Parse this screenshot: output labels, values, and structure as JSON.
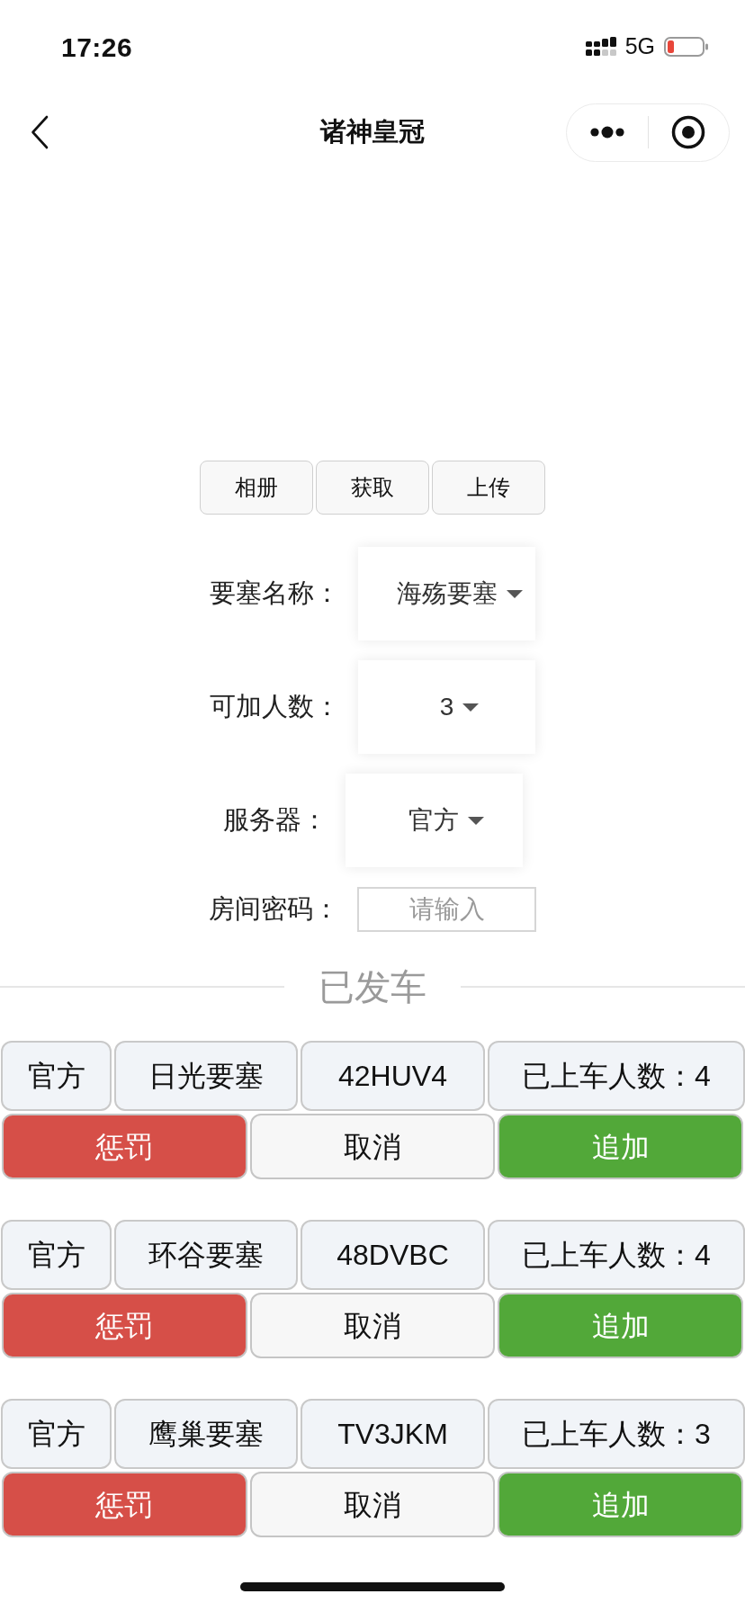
{
  "status_bar": {
    "time": "17:26",
    "network": "5G"
  },
  "nav_bar": {
    "title": "诸神皇冠"
  },
  "photo_buttons": [
    {
      "label": "相册"
    },
    {
      "label": "获取"
    },
    {
      "label": "上传"
    }
  ],
  "form": [
    {
      "kind": "select",
      "label": "要塞名称：",
      "value": "海殇要塞"
    },
    {
      "kind": "select",
      "label": "可加人数：",
      "value": "3"
    },
    {
      "kind": "select",
      "label": "服务器：",
      "value": "官方"
    },
    {
      "kind": "input",
      "label": "房间密码：",
      "placeholder": "请输入"
    }
  ],
  "section_title": "已发车",
  "departed": [
    {
      "server": "官方",
      "fortress": "日光要塞",
      "room_code": "42HUV4",
      "boarded": "已上车人数：4",
      "actions": [
        {
          "label": "惩罚",
          "kind": "danger"
        },
        {
          "label": "取消",
          "kind": "default"
        },
        {
          "label": "追加",
          "kind": "success"
        }
      ]
    },
    {
      "server": "官方",
      "fortress": "环谷要塞",
      "room_code": "48DVBC",
      "boarded": "已上车人数：4",
      "actions": [
        {
          "label": "惩罚",
          "kind": "danger"
        },
        {
          "label": "取消",
          "kind": "default"
        },
        {
          "label": "追加",
          "kind": "success"
        }
      ]
    },
    {
      "server": "官方",
      "fortress": "鹰巢要塞",
      "room_code": "TV3JKM",
      "boarded": "已上车人数：3",
      "actions": [
        {
          "label": "惩罚",
          "kind": "danger"
        },
        {
          "label": "取消",
          "kind": "default"
        },
        {
          "label": "追加",
          "kind": "success"
        }
      ]
    }
  ]
}
